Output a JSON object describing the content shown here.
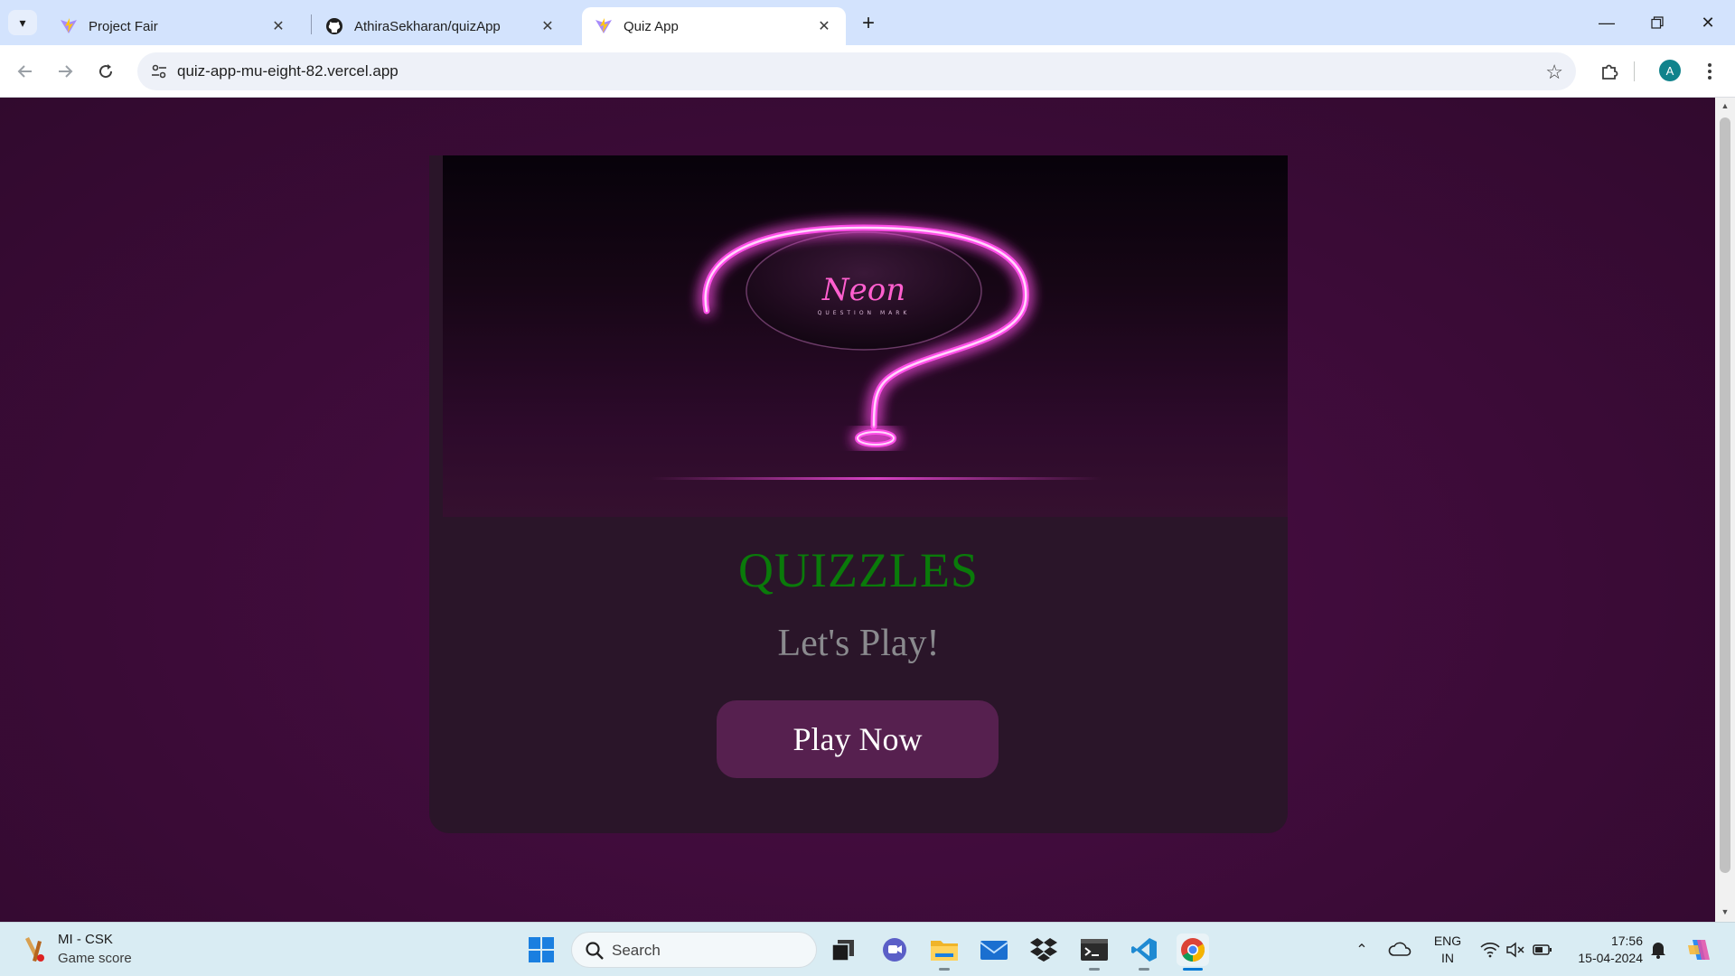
{
  "browser": {
    "tabs": [
      {
        "title": "Project Fair",
        "favicon": "vite-icon",
        "active": false
      },
      {
        "title": "AthiraSekharan/quizApp",
        "favicon": "github-icon",
        "active": false
      },
      {
        "title": "Quiz App",
        "favicon": "vite-icon",
        "active": true
      }
    ],
    "url": "quiz-app-mu-eight-82.vercel.app",
    "profile_initial": "A"
  },
  "page": {
    "hero_image": {
      "brand_text": "Neon",
      "tagline": "QUESTION MARK"
    },
    "app_title": "QUIZZLES",
    "subtitle": "Let's Play!",
    "play_button": "Play Now"
  },
  "taskbar": {
    "widget": {
      "title": "MI - CSK",
      "subtitle": "Game score"
    },
    "search_placeholder": "Search",
    "language": {
      "line1": "ENG",
      "line2": "IN"
    },
    "time": "17:56",
    "date": "15-04-2024"
  },
  "colors": {
    "page_bg": "#3b0b37",
    "card_bg": "#2a1529",
    "title_green": "#0a7a0a",
    "subtitle_gray": "#8a8a8e",
    "button_bg": "#56204f",
    "neon_pink": "#ff4fe8"
  }
}
